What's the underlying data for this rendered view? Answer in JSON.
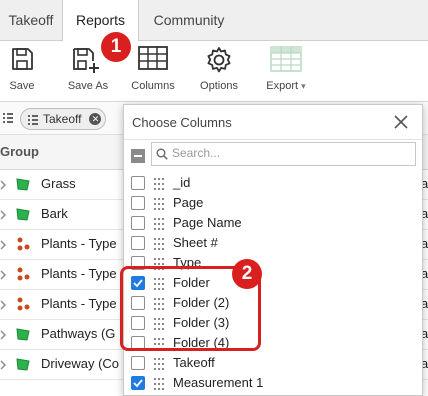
{
  "tabs": [
    {
      "label": "Takeoff",
      "active": false
    },
    {
      "label": "Reports",
      "active": true
    },
    {
      "label": "Community",
      "active": false
    }
  ],
  "toolbar": {
    "save_label": "Save",
    "save_as_label": "Save As",
    "columns_label": "Columns",
    "options_label": "Options",
    "export_label": "Export",
    "export_caret": "▾"
  },
  "annotations": {
    "badge1": "1",
    "badge2": "2",
    "accent": "#d9201e"
  },
  "filter": {
    "chip_label": "Takeoff",
    "chip_remove": "✕"
  },
  "grid": {
    "header_group": "Group",
    "rows": [
      {
        "name": "Grass",
        "icon": "area-shape-icon",
        "tail": "a"
      },
      {
        "name": "Bark",
        "icon": "area-shape-icon",
        "tail": "a"
      },
      {
        "name": "Plants - Type",
        "icon": "count-dots-icon",
        "tail": "a"
      },
      {
        "name": "Plants - Type",
        "icon": "count-dots-icon",
        "tail": "a"
      },
      {
        "name": "Plants - Type",
        "icon": "count-dots-icon",
        "tail": "a"
      },
      {
        "name": "Pathways (G",
        "icon": "area-shape-icon",
        "tail": "a"
      },
      {
        "name": "Driveway (Co",
        "icon": "area-shape-icon",
        "tail": "a"
      }
    ]
  },
  "popup": {
    "title": "Choose Columns",
    "search_placeholder": "Search...",
    "options": [
      {
        "label": "_id",
        "checked": false
      },
      {
        "label": "Page",
        "checked": false
      },
      {
        "label": "Page Name",
        "checked": false
      },
      {
        "label": "Sheet #",
        "checked": false
      },
      {
        "label": "Type",
        "checked": false
      },
      {
        "label": "Folder",
        "checked": true
      },
      {
        "label": "Folder (2)",
        "checked": false
      },
      {
        "label": "Folder (3)",
        "checked": false
      },
      {
        "label": "Folder (4)",
        "checked": false
      },
      {
        "label": "Takeoff",
        "checked": false
      },
      {
        "label": "Measurement 1",
        "checked": true
      }
    ]
  },
  "colors": {
    "checkbox_on": "#1e7be0",
    "area_icon": "#2bb24c",
    "count_icon": "#c84a1c"
  }
}
